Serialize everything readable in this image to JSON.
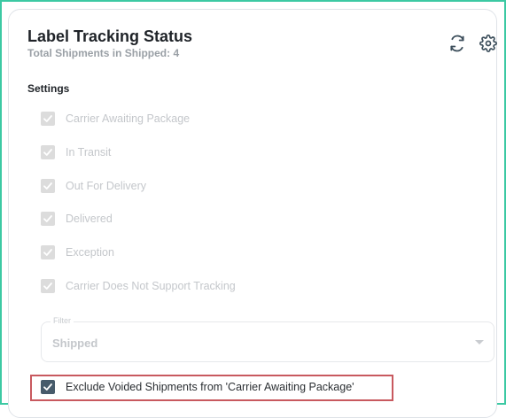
{
  "header": {
    "title": "Label Tracking Status",
    "subtitle": "Total Shipments in Shipped: 4",
    "icons": [
      "refresh-icon",
      "gear-icon"
    ]
  },
  "settings": {
    "heading": "Settings",
    "statuses": [
      {
        "label": "Carrier Awaiting Package",
        "checked": true,
        "disabled": true
      },
      {
        "label": "In Transit",
        "checked": true,
        "disabled": true
      },
      {
        "label": "Out For Delivery",
        "checked": true,
        "disabled": true
      },
      {
        "label": "Delivered",
        "checked": true,
        "disabled": true
      },
      {
        "label": "Exception",
        "checked": true,
        "disabled": true
      },
      {
        "label": "Carrier Does Not Support Tracking",
        "checked": true,
        "disabled": true
      }
    ],
    "filter": {
      "legend": "Filter",
      "value": "Shipped"
    },
    "exclude_voided": {
      "label": "Exclude Voided Shipments from 'Carrier Awaiting Package'",
      "checked": true
    }
  },
  "colors": {
    "frame": "#3cc9a3",
    "highlight": "#c8595f",
    "checkbox_active": "#475b6b",
    "checkbox_disabled": "#dcdcdc"
  }
}
